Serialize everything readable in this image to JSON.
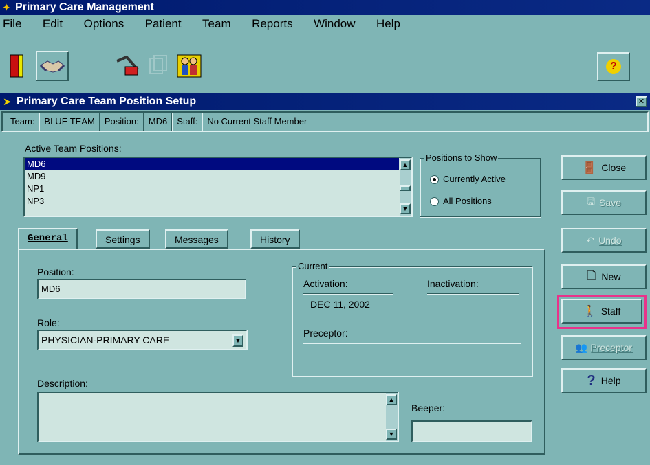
{
  "app": {
    "title": "Primary Care Management"
  },
  "menu": [
    "File",
    "Edit",
    "Options",
    "Patient",
    "Team",
    "Reports",
    "Window",
    "Help"
  ],
  "toolbar": {
    "icons": [
      "door-exit-icon",
      "handshake-icon",
      "red-arrow-icon",
      "copy-pages-icon",
      "team-people-icon",
      "help-question-icon"
    ],
    "help_glyph": "?"
  },
  "dialog": {
    "title": "Primary Care Team Position Setup",
    "close_glyph": "✕",
    "status": {
      "team_label": "Team:",
      "team_value": "BLUE TEAM",
      "position_label": "Position:",
      "position_value": "MD6",
      "staff_label": "Staff:",
      "staff_value": "No Current Staff Member"
    },
    "active_positions": {
      "label": "Active Team Positions:",
      "items": [
        "MD6",
        "MD9",
        "NP1",
        "NP3"
      ],
      "selected_index": 0
    },
    "positions_to_show": {
      "title": "Positions to Show",
      "options": [
        "Currently Active",
        "All Positions"
      ],
      "selected_index": 0
    },
    "tabs": [
      "General",
      "Settings",
      "Messages",
      "History"
    ],
    "general": {
      "position_label": "Position:",
      "position_value": "MD6",
      "role_label": "Role:",
      "role_value": "PHYSICIAN-PRIMARY CARE",
      "description_label": "Description:",
      "description_value": "",
      "beeper_label": "Beeper:",
      "beeper_value": "",
      "current": {
        "title": "Current",
        "activation_label": "Activation:",
        "inactivation_label": "Inactivation:",
        "activation_value": "DEC 11, 2002",
        "preceptor_label": "Preceptor:"
      }
    },
    "buttons": {
      "close": "Close",
      "save": "Save",
      "undo": "Undo",
      "new": "New",
      "staff": "Staff",
      "preceptor": "Preceptor",
      "help": "Help"
    },
    "highlight_color": "#e8338a"
  },
  "colors": {
    "background": "#7fb5b5",
    "titlebar": "#001a6e",
    "selection": "#000a80"
  }
}
